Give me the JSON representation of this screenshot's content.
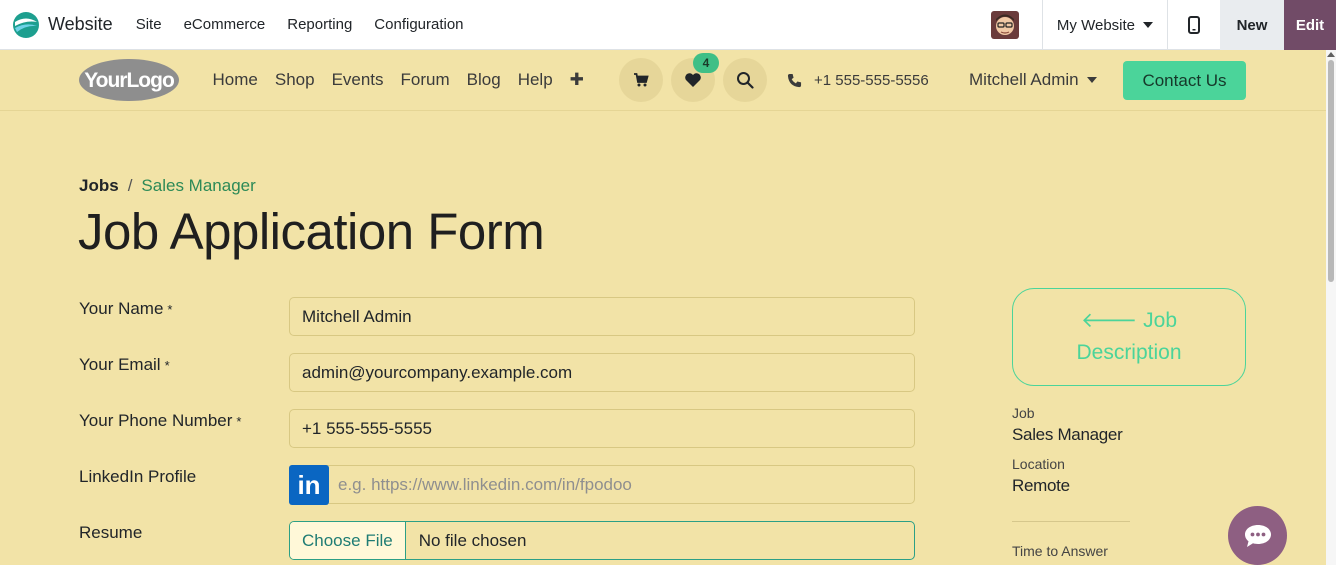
{
  "admin": {
    "brand": "Website",
    "menu": [
      "Site",
      "eCommerce",
      "Reporting",
      "Configuration"
    ],
    "website_switcher": "My Website",
    "new_label": "New",
    "edit_label": "Edit"
  },
  "site": {
    "logo_text": "YourLogo",
    "nav": [
      "Home",
      "Shop",
      "Events",
      "Forum",
      "Blog",
      "Help"
    ],
    "wishlist_count": "4",
    "phone": "+1 555-555-5556",
    "user": "Mitchell Admin",
    "contact_button": "Contact Us"
  },
  "breadcrumb": {
    "parent": "Jobs",
    "separator": "/",
    "current": "Sales Manager"
  },
  "page_title": "Job Application Form",
  "form": {
    "name": {
      "label": "Your Name",
      "required": "*",
      "value": "Mitchell Admin"
    },
    "email": {
      "label": "Your Email",
      "required": "*",
      "value": "admin@yourcompany.example.com"
    },
    "phone": {
      "label": "Your Phone Number",
      "required": "*",
      "value": "+1 555-555-5555"
    },
    "linkedin": {
      "label": "LinkedIn Profile",
      "placeholder": "e.g. https://www.linkedin.com/in/fpodoo",
      "icon_text": "in"
    },
    "resume": {
      "label": "Resume",
      "button": "Choose File",
      "status": "No file chosen"
    }
  },
  "sidebar": {
    "job_description_line1": "Job",
    "job_description_line2": "Description",
    "job_label": "Job",
    "job_value": "Sales Manager",
    "location_label": "Location",
    "location_value": "Remote",
    "time_label": "Time to Answer"
  },
  "colors": {
    "page_bg": "#f2e3a7",
    "accent_green": "#4bd49a",
    "edit_purple": "#714b67",
    "linkedin_blue": "#0a66c2"
  }
}
